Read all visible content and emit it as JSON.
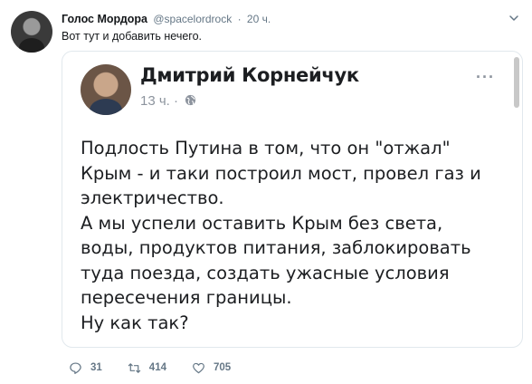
{
  "tweet": {
    "display_name": "Голос Мордора",
    "handle": "@spacelordrock",
    "separator": "·",
    "time": "20 ч.",
    "text": "Вот тут и добавить нечего."
  },
  "embedded_post": {
    "author": "Дмитрий Корнейчук",
    "time": "13 ч. ·",
    "more": "···",
    "lines": [
      "Подлость Путина в том, что он \"отжал\"",
      "Крым - и таки построил мост, провел газ и",
      "электричество.",
      "А мы успели оставить Крым без света,",
      "воды, продуктов питания, заблокировать",
      "туда поезда, создать ужасные условия",
      "пересечения границы.",
      "Ну как так?"
    ]
  },
  "actions": {
    "replies": "31",
    "retweets": "414",
    "likes": "705"
  },
  "icons": {
    "reply": "speech-bubble-icon",
    "retweet": "retweet-arrows-icon",
    "like": "heart-icon",
    "menu": "chevron-down-icon",
    "privacy": "globe-icon"
  },
  "colors": {
    "secondary_text": "#657786",
    "border": "#e1e8ed",
    "fb_meta": "#8d949e"
  }
}
